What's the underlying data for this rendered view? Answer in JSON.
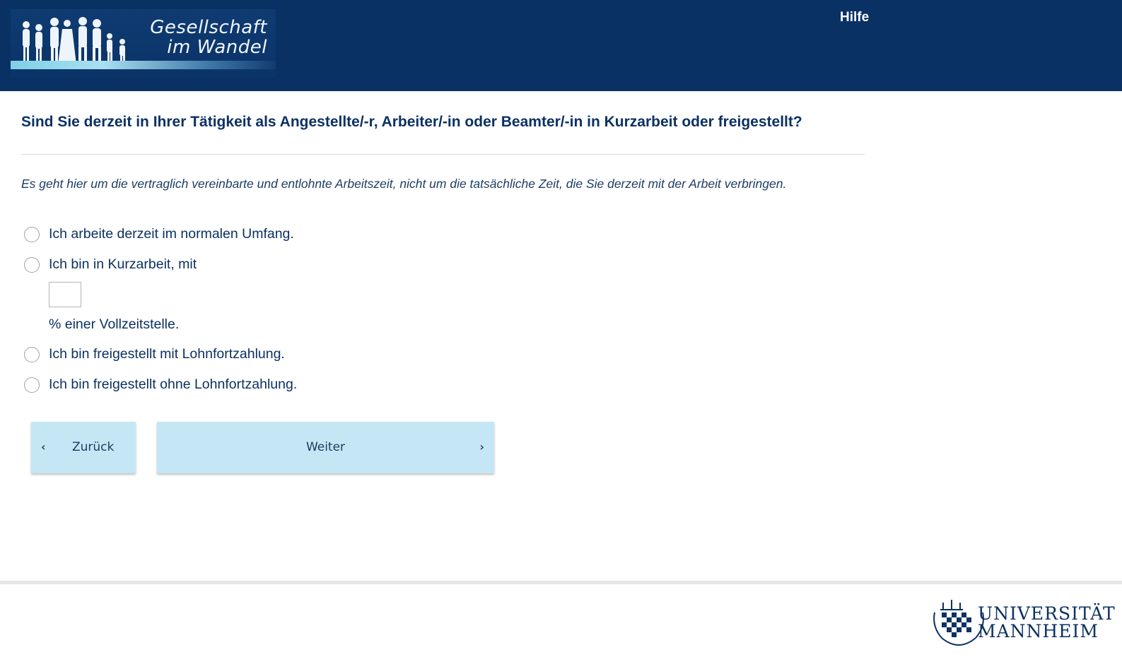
{
  "header": {
    "logo_line1": "Gesellschaft",
    "logo_line2": "im Wandel",
    "help_label": "Hilfe"
  },
  "question": {
    "title": "Sind Sie derzeit in Ihrer Tätigkeit als Angestellte/-r, Arbeiter/-in oder Beamter/-in in Kurzarbeit oder freigestellt?",
    "hint": "Es geht hier um die vertraglich vereinbarte und entlohnte Arbeitszeit, nicht um die tatsächliche Zeit, die Sie derzeit mit der Arbeit verbringen.",
    "options": [
      {
        "label": "Ich arbeite derzeit im normalen Umfang."
      },
      {
        "label": "Ich bin in Kurzarbeit, mit"
      },
      {
        "label": "Ich bin freigestellt mit Lohnfortzahlung."
      },
      {
        "label": "Ich bin freigestellt ohne Lohnfortzahlung."
      }
    ],
    "percent_input_value": "",
    "percent_suffix": "% einer Vollzeitstelle."
  },
  "navigation": {
    "back_label": "Zurück",
    "next_label": "Weiter"
  },
  "footer": {
    "university_line1": "UNIVERSITÄT",
    "university_line2": "MANNHEIM"
  },
  "colors": {
    "header_bg": "#0a3163",
    "button_bg": "#c5e7f5",
    "text_primary": "#0c3163"
  }
}
